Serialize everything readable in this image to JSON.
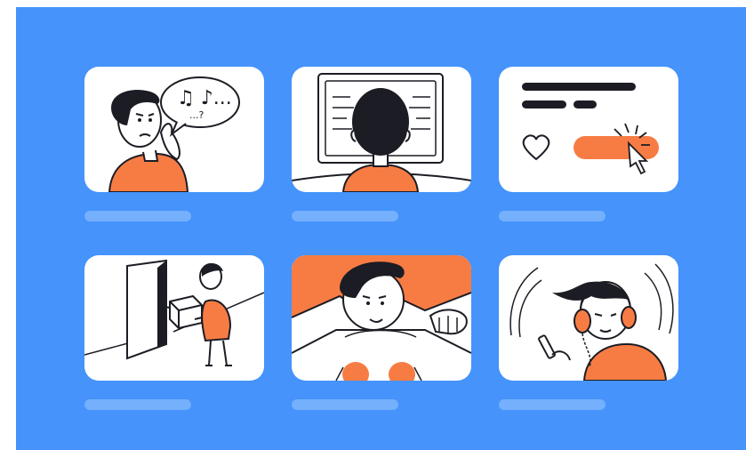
{
  "colors": {
    "background": "#4593fb",
    "card": "#ffffff",
    "caption_placeholder": "#75b0fd",
    "accent_orange": "#f77c44",
    "ink": "#1c1c24"
  },
  "cards": [
    {
      "name": "confused-by-music-illustration",
      "music_notes_text": "♫ ♪...",
      "dots_text": "...?"
    },
    {
      "name": "person-at-computer-illustration"
    },
    {
      "name": "like-button-click-illustration"
    },
    {
      "name": "package-delivery-illustration"
    },
    {
      "name": "sitting-at-desk-illustration"
    },
    {
      "name": "listening-headphones-illustration"
    }
  ]
}
